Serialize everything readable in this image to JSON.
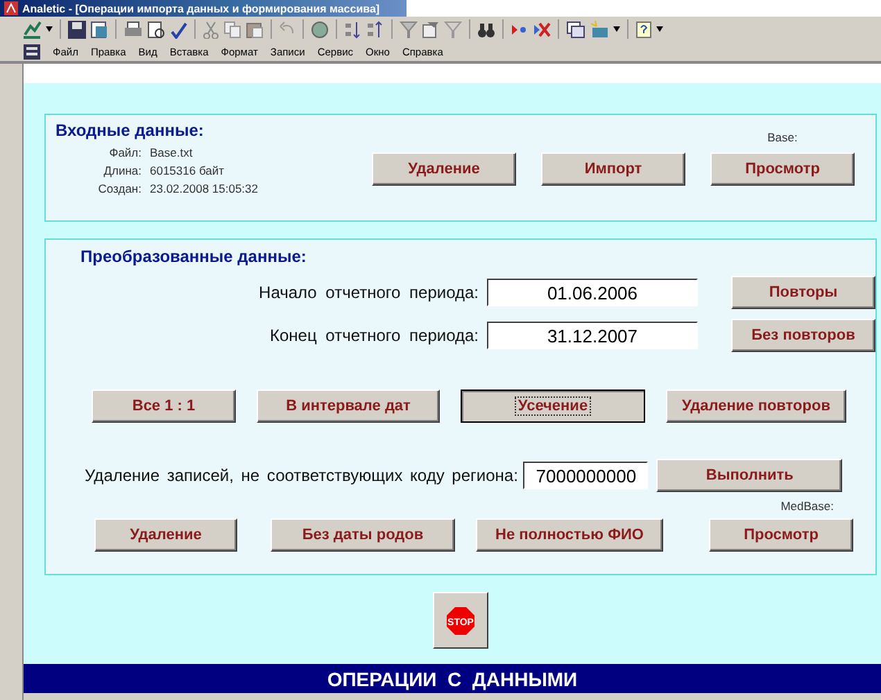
{
  "window": {
    "title": "Analetic - [Операции импорта данных и формирования массива]"
  },
  "menu": [
    {
      "label": "Файл"
    },
    {
      "label": "Правка"
    },
    {
      "label": "Вид"
    },
    {
      "label": "Вставка"
    },
    {
      "label": "Формат"
    },
    {
      "label": "Записи"
    },
    {
      "label": "Сервис"
    },
    {
      "label": "Окно"
    },
    {
      "label": "Справка"
    }
  ],
  "input_section": {
    "heading": "Входные данные:",
    "fields": [
      {
        "label": "Файл:",
        "value": "Base.txt"
      },
      {
        "label": "Длина:",
        "value": "6015316 байт"
      },
      {
        "label": "Создан:",
        "value": "23.02.2008 15:05:32"
      }
    ],
    "caption": "Base:",
    "buttons": [
      {
        "label": "Удаление"
      },
      {
        "label": "Импорт"
      },
      {
        "label": "Просмотр"
      }
    ]
  },
  "output_section": {
    "heading": "Преобразованные данные:",
    "period": [
      {
        "label": "Начало отчетного периода:",
        "value": "01.06.2006",
        "button": "Повторы"
      },
      {
        "label": "Конец отчетного периода:",
        "value": "31.12.2007",
        "button": "Без повторов"
      }
    ],
    "mode_buttons": [
      {
        "label": "Все 1 : 1",
        "focused": false
      },
      {
        "label": "В интервале дат",
        "focused": false
      },
      {
        "label": "Усечение",
        "focused": true
      },
      {
        "label": "Удаление повторов",
        "focused": false
      }
    ],
    "region": {
      "label": "Удаление записей, не соответствующих коду региона:",
      "value": "7000000000",
      "button": "Выполнить"
    },
    "caption": "MedBase:",
    "bottom_buttons": [
      {
        "label": "Удаление"
      },
      {
        "label": "Без даты родов"
      },
      {
        "label": "Не полностью ФИО"
      },
      {
        "label": "Просмотр"
      }
    ]
  },
  "stop_button": {
    "label": "STOP"
  },
  "footer": "ОПЕРАЦИИ  С  ДАННЫМИ"
}
